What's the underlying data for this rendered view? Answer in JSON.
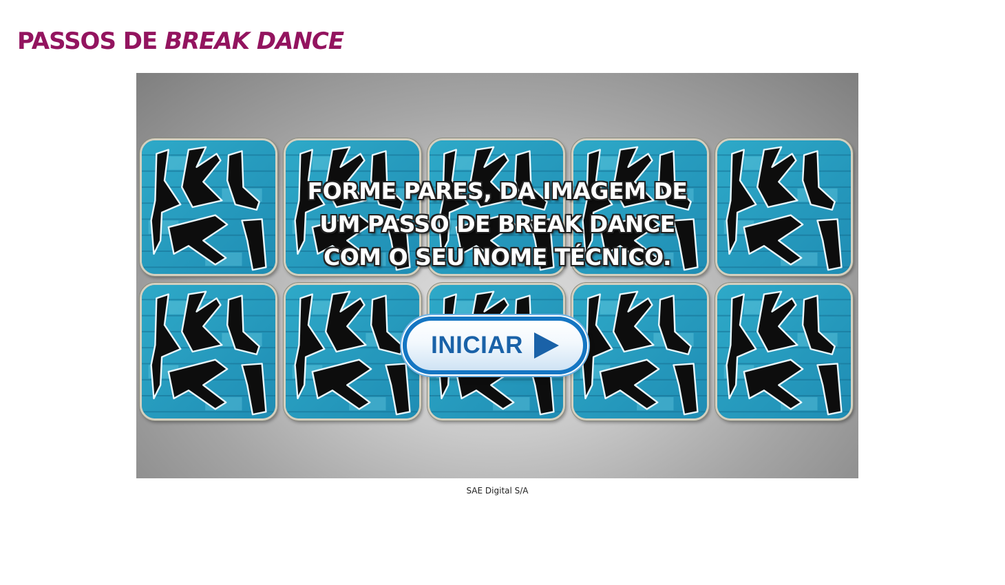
{
  "title": {
    "plain": "PASSOS DE ",
    "italic": "BREAK DANCE",
    "color": "#93145f"
  },
  "game": {
    "card_back_icon": "graffiti-card-back",
    "card_count": 10,
    "instructions": [
      "FORME PARES, DA IMAGEM DE",
      "UM PASSO DE BREAK DANCE",
      "COM O SEU NOME TÉCNICO."
    ],
    "start_button": {
      "label": "INICIAR",
      "icon": "play-icon",
      "color": "#1576c3"
    }
  },
  "footer": {
    "copyright": "SAE Digital S/A"
  }
}
